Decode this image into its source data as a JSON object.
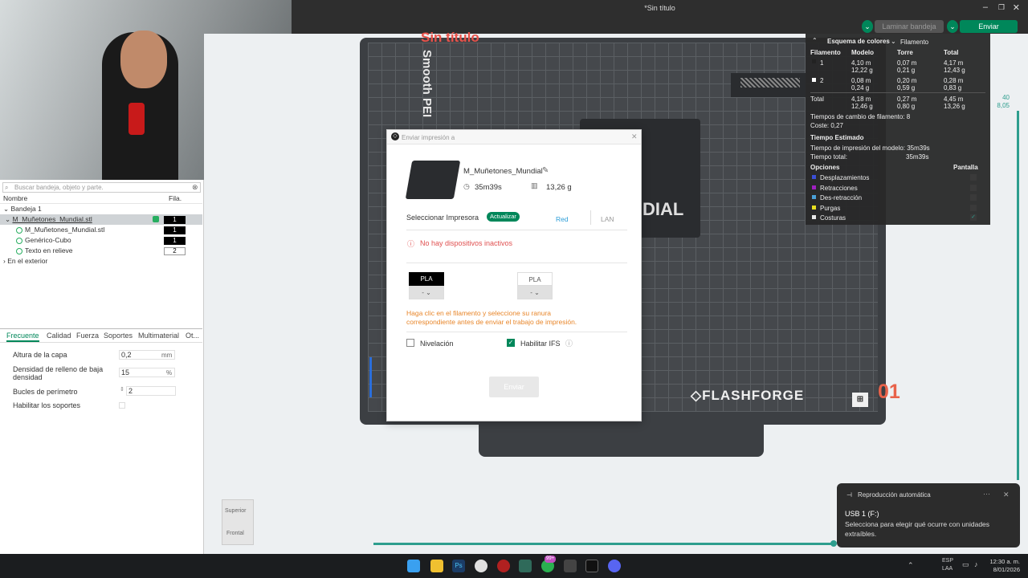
{
  "window": {
    "title": "*Sin título"
  },
  "toolbar": {
    "slice_label": "Laminar bandeja",
    "send_label": "Enviar"
  },
  "objects": {
    "search_placeholder": "Buscar bandeja, objeto y parte.",
    "col_name": "Nombre",
    "col_fila": "Fila.",
    "rows": [
      {
        "label": "Bandeja 1",
        "fila": ""
      },
      {
        "label": "M_Muñetones_Mundial.stl",
        "fila": "1"
      },
      {
        "label": "M_Muñetones_Mundial.stl",
        "fila": "1"
      },
      {
        "label": "Genérico-Cubo",
        "fila": "1"
      },
      {
        "label": "Texto en relieve",
        "fila": "2"
      },
      {
        "label": "En el exterior",
        "fila": ""
      }
    ]
  },
  "settings": {
    "tabs": [
      "Frecuente",
      "Calidad",
      "Fuerza",
      "Soportes",
      "Multimaterial",
      "Ot..."
    ],
    "layer_height": {
      "label": "Altura de la capa",
      "value": "0,2",
      "unit": "mm"
    },
    "infill": {
      "label": "Densidad de relleno de baja densidad",
      "value": "15",
      "unit": "%"
    },
    "walls": {
      "label": "Bucles de perímetro",
      "value": "2"
    },
    "supports": {
      "label": "Habilitar los soportes"
    }
  },
  "plate": {
    "title": "Sin título",
    "smooth": "Smooth PEI",
    "brand": "FLASHFORGE",
    "number": "01",
    "dial_text": "DIAL"
  },
  "view_cube": {
    "top": "Superior",
    "front": "Frontal"
  },
  "layer_slider": {
    "top": "40",
    "top2": "8,05"
  },
  "color_scheme": {
    "header": "Esquema de colores",
    "mode": "Filamento",
    "cols": [
      "Filamento",
      "Modelo",
      "Torre",
      "Total"
    ],
    "rows": [
      {
        "id": "1",
        "modelo_m": "4,10 m",
        "modelo_g": "12,22 g",
        "torre_m": "0,07 m",
        "torre_g": "0,21 g",
        "total_m": "4,17 m",
        "total_g": "12,43 g"
      },
      {
        "id": "2",
        "modelo_m": "0,08 m",
        "modelo_g": "0,24 g",
        "torre_m": "0,20 m",
        "torre_g": "0,59 g",
        "total_m": "0,28 m",
        "total_g": "0,83 g"
      }
    ],
    "total": {
      "label": "Total",
      "modelo_m": "4,18 m",
      "modelo_g": "12,46 g",
      "torre_m": "0,27 m",
      "torre_g": "0,80 g",
      "total_m": "4,45 m",
      "total_g": "13,26 g"
    },
    "changes": "Tiempos de cambio de filamento:  8",
    "cost": "Coste:  0,27",
    "est_header": "Tiempo Estimado",
    "print_time": "Tiempo de impresión del modelo: 35m39s",
    "total_time_label": "Tiempo total:",
    "total_time": "35m39s",
    "options_header": "Opciones",
    "screen_header": "Pantalla",
    "options": [
      {
        "label": "Desplazamientos",
        "color": "#3b4fd6"
      },
      {
        "label": "Retracciones",
        "color": "#a020c0"
      },
      {
        "label": "Des-retracción",
        "color": "#4aa0d8"
      },
      {
        "label": "Purgas",
        "color": "#e8e020"
      },
      {
        "label": "Costuras",
        "color": "#e8e8e8"
      }
    ]
  },
  "dialog": {
    "title": "Enviar impresión a",
    "model_name": "M_Muñetones_Mundial",
    "time": "35m39s",
    "weight": "13,26 g",
    "select_printer": "Seleccionar Impresora",
    "refresh": "Actualizar",
    "tab_red": "Red",
    "tab_lan": "LAN",
    "error": "No hay dispositivos inactivos",
    "chip1": {
      "label": "PLA",
      "slot": "- "
    },
    "chip2": {
      "label": "PLA",
      "slot": "- "
    },
    "hint": "Haga clic en el filamento y seleccione su ranura correspondiente antes de enviar el trabajo de impresión.",
    "leveling": "Nivelación",
    "ifs": "Habilitar IFS",
    "send": "Enviar",
    "accent": "#00875a",
    "error_color": "#e05050",
    "hint_color": "#e8862a"
  },
  "toast": {
    "title": "Reproducción automática",
    "device": "USB 1 (F:)",
    "body": "Selecciona para elegir qué ocurre con unidades extraíbles."
  },
  "taskbar": {
    "lang": "ESP",
    "lang2": "LAA",
    "time": "12:30 a. m.",
    "date": "8/01/2026",
    "badge": "99+"
  }
}
